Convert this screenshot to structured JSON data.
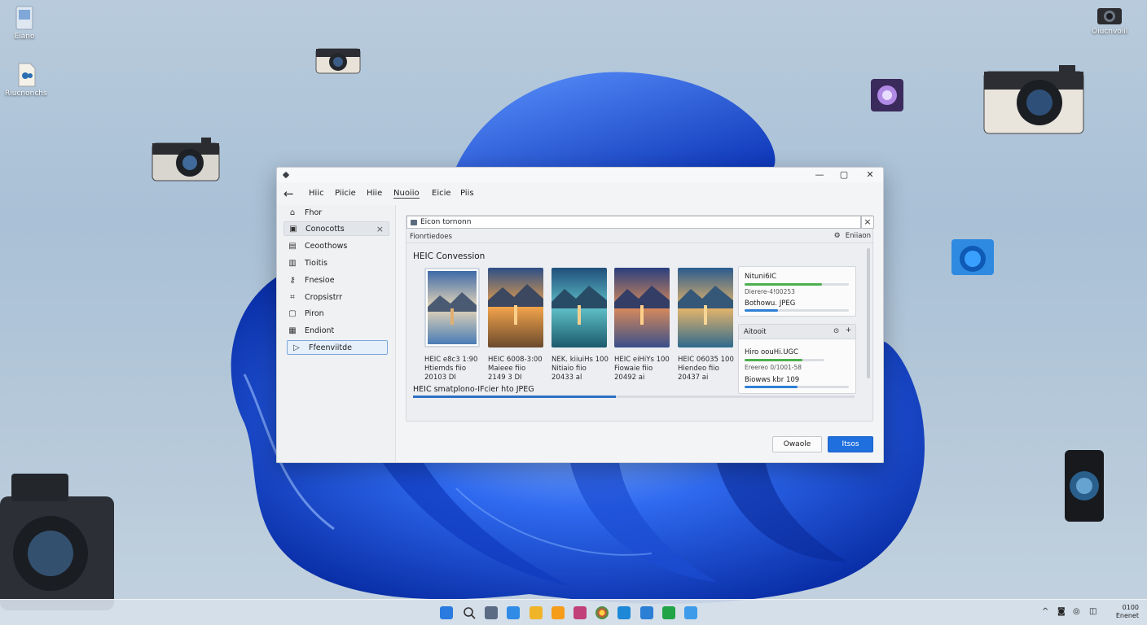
{
  "desktop": {
    "icons": [
      {
        "label": "Eiano"
      },
      {
        "label": "Riucnonchs"
      },
      {
        "label": "Oiucnvoiil"
      }
    ]
  },
  "window": {
    "menu": {
      "items": [
        "Hiic",
        "Piicie",
        "Hiie",
        "Nuoiio",
        "Eicie",
        "Piis"
      ]
    },
    "sidebar": {
      "items": [
        {
          "label": "Fhor",
          "icon": "home-icon"
        },
        {
          "label": "Conocotts",
          "icon": "image-icon"
        },
        {
          "label": "Ceoothows",
          "icon": "image-icon"
        },
        {
          "label": "Tioitis",
          "icon": "folder-icon"
        },
        {
          "label": "Fnesioe",
          "icon": "key-icon"
        },
        {
          "label": "Cropsistrr",
          "icon": "crop-icon"
        },
        {
          "label": "Piron",
          "icon": "photo-icon"
        },
        {
          "label": "Endiont",
          "icon": "grid-icon"
        },
        {
          "label": "Ffeenviitde",
          "icon": "play-icon"
        }
      ]
    },
    "address": {
      "path": "Eicon tornonn"
    },
    "toolbar": {
      "left_label": "Fionrtiedoes",
      "right_label": "Eniiaon"
    },
    "section_title": "HEIC Convession",
    "thumbnails": [
      {
        "line1": "HEIC e8c3 1:90",
        "line2": "Htiemds fiio",
        "line3": "20103 DI"
      },
      {
        "line1": "HEIC 6008-3:00",
        "line2": "Maieee fiio",
        "line3": "2149 3 DI"
      },
      {
        "line1": "NEK. kiiuiHs 100",
        "line2": "Nitiaio fiio",
        "line3": "20433 al"
      },
      {
        "line1": "HEIC eiHiYs 100",
        "line2": "Fiowaie fiio",
        "line3": "20492 ai"
      },
      {
        "line1": "HEIC 06035 100",
        "line2": "Hiendeo fiio",
        "line3": "20437 ai"
      }
    ],
    "panel1": {
      "title": "Nituni6IC",
      "row1": "Dierere-4!00253",
      "row1_progress": 0.74,
      "row2": "Bothowu. JPEG",
      "row2_progress": 0.32
    },
    "panel2": {
      "header": "Aitooit",
      "title": "Hiro oouHi.UGC",
      "row1": "Ereereo 0/1001-58",
      "row1_progress": 0.72,
      "row2": "Biowws kbr 109",
      "row2_progress": 0.51
    },
    "progress": {
      "label": "HEIC smatplono-IFcier hto JPEG",
      "fraction": 0.46
    },
    "buttons": {
      "secondary": "Owaole",
      "primary": "Itsos"
    }
  },
  "taskbar": {
    "clock": {
      "line1": "0100",
      "line2": "Enenet"
    }
  },
  "colors": {
    "accent": "#1f6fde",
    "progress_green": "#4caf50",
    "progress_blue": "#2f7fd6"
  }
}
